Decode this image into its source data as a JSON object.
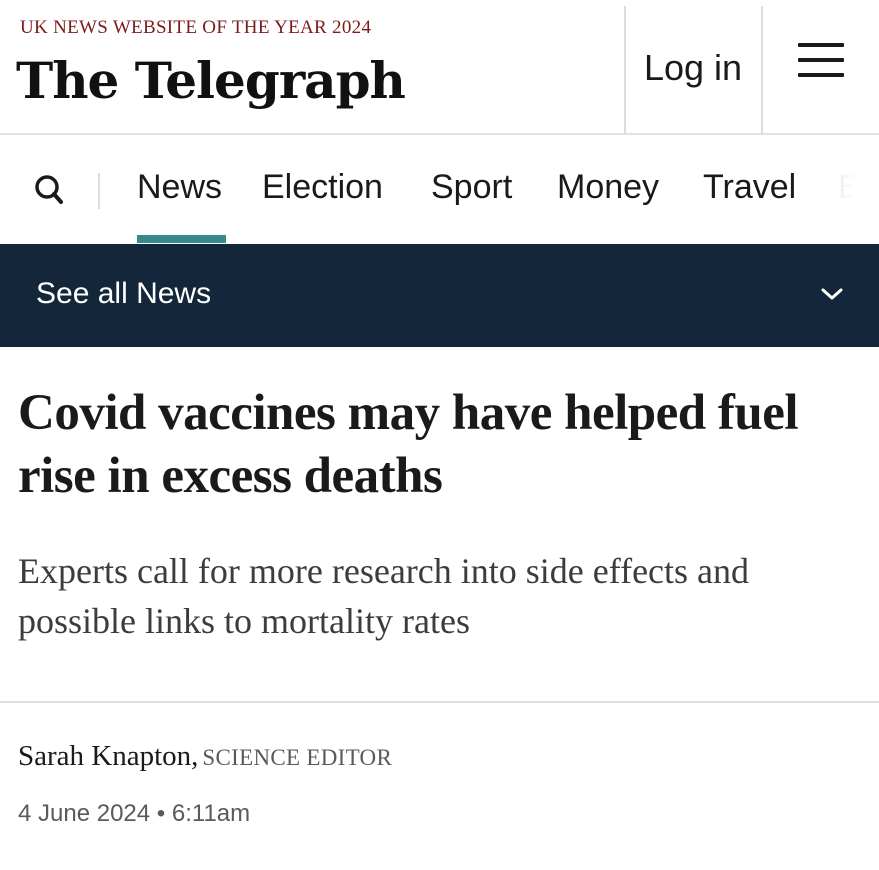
{
  "header": {
    "award": "UK NEWS WEBSITE OF THE YEAR 2024",
    "logo": "The Telegraph",
    "login_label": "Log in",
    "menu_icon": "hamburger-menu-icon"
  },
  "nav": {
    "search_icon": "search-icon",
    "items": [
      {
        "label": "News"
      },
      {
        "label": "Election"
      },
      {
        "label": "Sport"
      },
      {
        "label": "Money"
      },
      {
        "label": "Travel"
      },
      {
        "label": "B"
      }
    ],
    "active_index": 0
  },
  "section_bar": {
    "label": "See all News",
    "chevron_icon": "chevron-down-icon"
  },
  "article": {
    "headline": "Covid vaccines may have helped fuel rise in excess deaths",
    "standfirst": "Experts call for more research into side effects and possible links to mortality rates",
    "author": "Sarah Knapton,",
    "author_role": "SCIENCE EDITOR",
    "dateline": "4 June 2024 • 6:11am"
  },
  "colors": {
    "award_text": "#7d1a1a",
    "nav_active_underline": "#358a8c",
    "section_bar_bg": "#14273a"
  }
}
